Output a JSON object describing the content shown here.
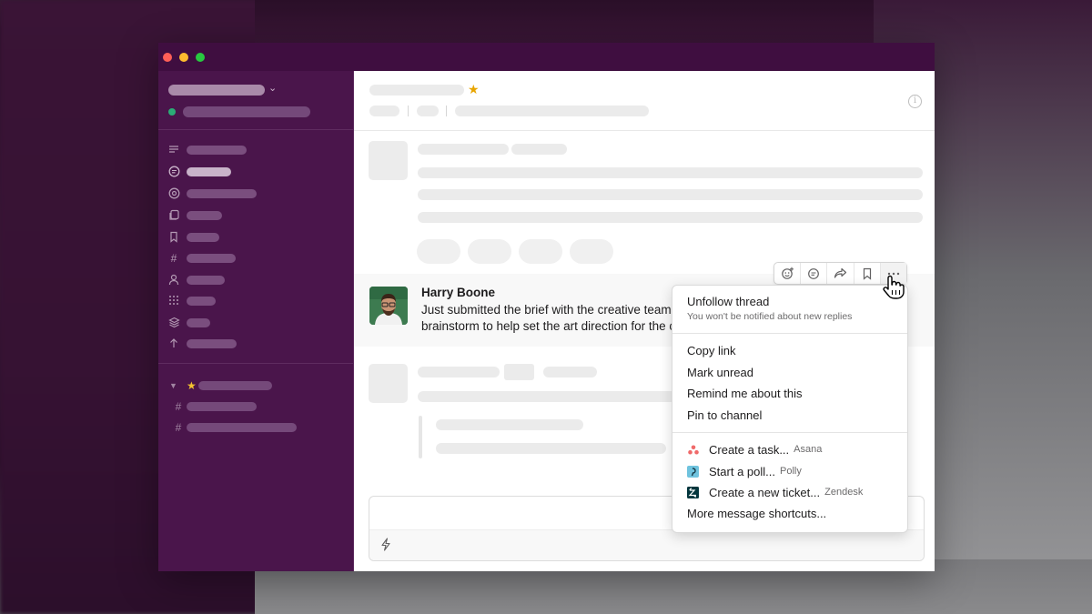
{
  "window": {
    "traffic_lights": {
      "close": "#ff5f57",
      "minimize": "#febc2e",
      "maximize": "#28c840"
    }
  },
  "colors": {
    "sidebar": "#4a154b",
    "titlebar": "#3f0e40",
    "status_online": "#2bac76",
    "star": "#e8a500"
  },
  "message": {
    "author": "Harry Boone",
    "line1": "Just submitted the brief with the creative team.",
    "line2": "brainstorm to help set the art direction for the c"
  },
  "toolbar": {
    "icons": [
      "add-reaction-icon",
      "reply-in-thread-icon",
      "share-message-icon",
      "save-bookmark-icon",
      "more-actions-icon"
    ]
  },
  "context_menu": {
    "unfollow": {
      "label": "Unfollow thread",
      "sub": "You won't be notified about new replies"
    },
    "group2": [
      "Copy link",
      "Mark unread",
      "Remind me about this",
      "Pin to channel"
    ],
    "apps": [
      {
        "label": "Create a task...",
        "source": "Asana",
        "icon": "asana-icon"
      },
      {
        "label": "Start a poll...",
        "source": "Polly",
        "icon": "polly-icon"
      },
      {
        "label": "Create a new ticket...",
        "source": "Zendesk",
        "icon": "zendesk-icon"
      }
    ],
    "more": "More message shortcuts..."
  },
  "sidebar": {
    "nav_icons": [
      "threads-icon",
      "dms-icon",
      "mentions-icon",
      "drafts-icon",
      "saved-items-icon",
      "channel-browser-icon",
      "people-icon",
      "apps-icon",
      "files-icon",
      "show-less-icon"
    ],
    "sections": [
      "starred-section"
    ]
  }
}
